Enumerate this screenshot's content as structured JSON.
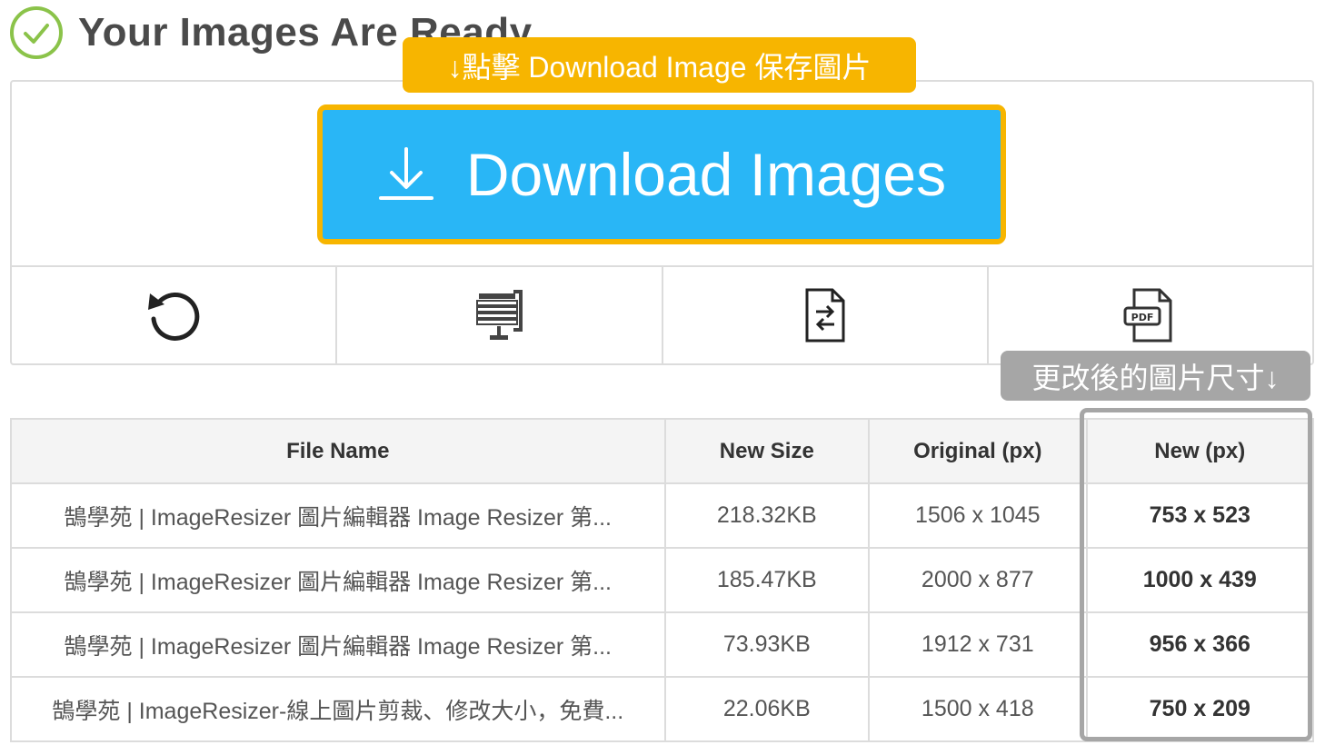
{
  "header": {
    "title": "Your Images Are Ready"
  },
  "download": {
    "label": "Download Images"
  },
  "tools": [
    {
      "name": "restart",
      "icon": "undo-icon"
    },
    {
      "name": "compress",
      "icon": "compress-clamp-icon"
    },
    {
      "name": "convert",
      "icon": "file-convert-icon"
    },
    {
      "name": "pdf",
      "icon": "pdf-file-icon"
    }
  ],
  "callouts": {
    "download_hint": "↓點擊 Download Image 保存圖片",
    "size_hint": "更改後的圖片尺寸↓"
  },
  "table": {
    "headers": [
      "File Name",
      "New Size",
      "Original (px)",
      "New (px)"
    ],
    "rows": [
      {
        "name": "鵠學苑 | ImageResizer 圖片編輯器 Image Resizer 第...",
        "size": "218.32KB",
        "original": "1506 x 1045",
        "new": "753 x 523"
      },
      {
        "name": "鵠學苑 | ImageResizer 圖片編輯器 Image Resizer 第...",
        "size": "185.47KB",
        "original": "2000 x 877",
        "new": "1000 x 439"
      },
      {
        "name": "鵠學苑 | ImageResizer 圖片編輯器 Image Resizer 第...",
        "size": "73.93KB",
        "original": "1912 x 731",
        "new": "956 x 366"
      },
      {
        "name": "鵠學苑 | ImageResizer-線上圖片剪裁、修改大小，免費...",
        "size": "22.06KB",
        "original": "1500 x 418",
        "new": "750 x 209"
      }
    ]
  },
  "colors": {
    "accent_blue": "#29b6f6",
    "callout_yellow": "#f7b500",
    "callout_gray": "#a6a6a6",
    "success_green": "#8bc34a"
  }
}
